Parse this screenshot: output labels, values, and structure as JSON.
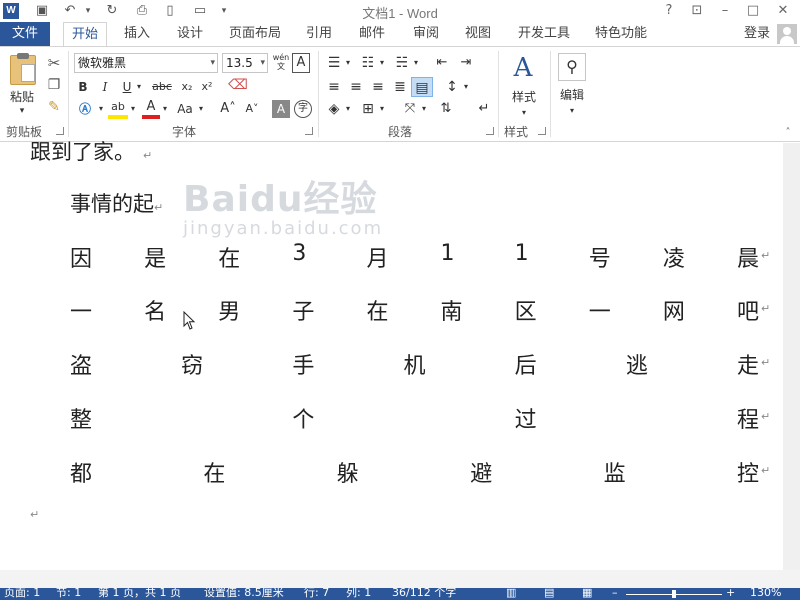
{
  "titlebar": {
    "logo": "W",
    "title": "文档1 - Word",
    "help": "?"
  },
  "tabs": {
    "file": "文件",
    "items": [
      "开始",
      "插入",
      "设计",
      "页面布局",
      "引用",
      "邮件",
      "审阅",
      "视图",
      "开发工具",
      "特色功能"
    ],
    "login": "登录"
  },
  "ribbon": {
    "clipboard": {
      "paste": "粘贴",
      "label": "剪贴板"
    },
    "font": {
      "name": "微软雅黑",
      "size": "13.5",
      "label": "字体",
      "wen": "wén\n文",
      "char_a": "A",
      "char_border": "字",
      "aa": "Aa"
    },
    "paragraph": {
      "label": "段落"
    },
    "styles": {
      "button": "样式",
      "label": "样式"
    },
    "editing": {
      "button": "编辑"
    }
  },
  "document": {
    "top_line": "跟到了家。",
    "line1": "事情的起",
    "rows": [
      [
        "因",
        "是",
        "在",
        "3",
        "月",
        "1",
        "1",
        "号",
        "凌",
        "晨"
      ],
      [
        "一",
        "名",
        "男",
        "子",
        "在",
        "南",
        "区",
        "一",
        "网",
        "吧"
      ],
      [
        "盗",
        "窃",
        "手",
        "机",
        "后",
        "逃",
        "走"
      ],
      [
        "整",
        "个",
        "过",
        "程"
      ],
      [
        "都",
        "在",
        "躲",
        "避",
        "监",
        "控"
      ]
    ],
    "para_mark": "↵",
    "watermark_main": "Baidu经验",
    "watermark_sub": "jingyan.baidu.com"
  },
  "statusbar": {
    "page": "页面: 1",
    "section": "节: 1",
    "pages": "第 1 页，共 1 页",
    "position": "设置值: 8.5厘米",
    "row": "行: 7",
    "col": "列: 1",
    "words": "36/112 个字",
    "zoom": "130%"
  },
  "colors": {
    "accent": "#2b579a"
  }
}
